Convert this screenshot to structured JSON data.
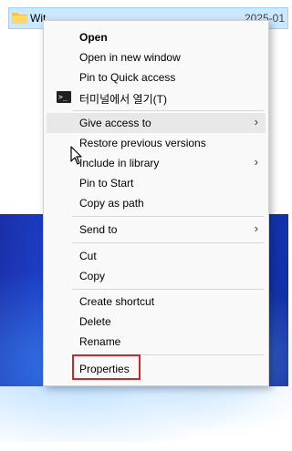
{
  "file": {
    "name": "Wit",
    "date": "2025-01"
  },
  "menu": {
    "open": "Open",
    "open_new_window": "Open in new window",
    "pin_quick_access": "Pin to Quick access",
    "open_terminal": "터미널에서 열기(T)",
    "give_access": "Give access to",
    "restore_versions": "Restore previous versions",
    "include_library": "Include in library",
    "pin_start": "Pin to Start",
    "copy_path": "Copy as path",
    "send_to": "Send to",
    "cut": "Cut",
    "copy": "Copy",
    "create_shortcut": "Create shortcut",
    "delete": "Delete",
    "rename": "Rename",
    "properties": "Properties",
    "submenu_arrow": "›"
  },
  "colors": {
    "selection": "#cce8ff",
    "highlight_box": "#e02020"
  }
}
